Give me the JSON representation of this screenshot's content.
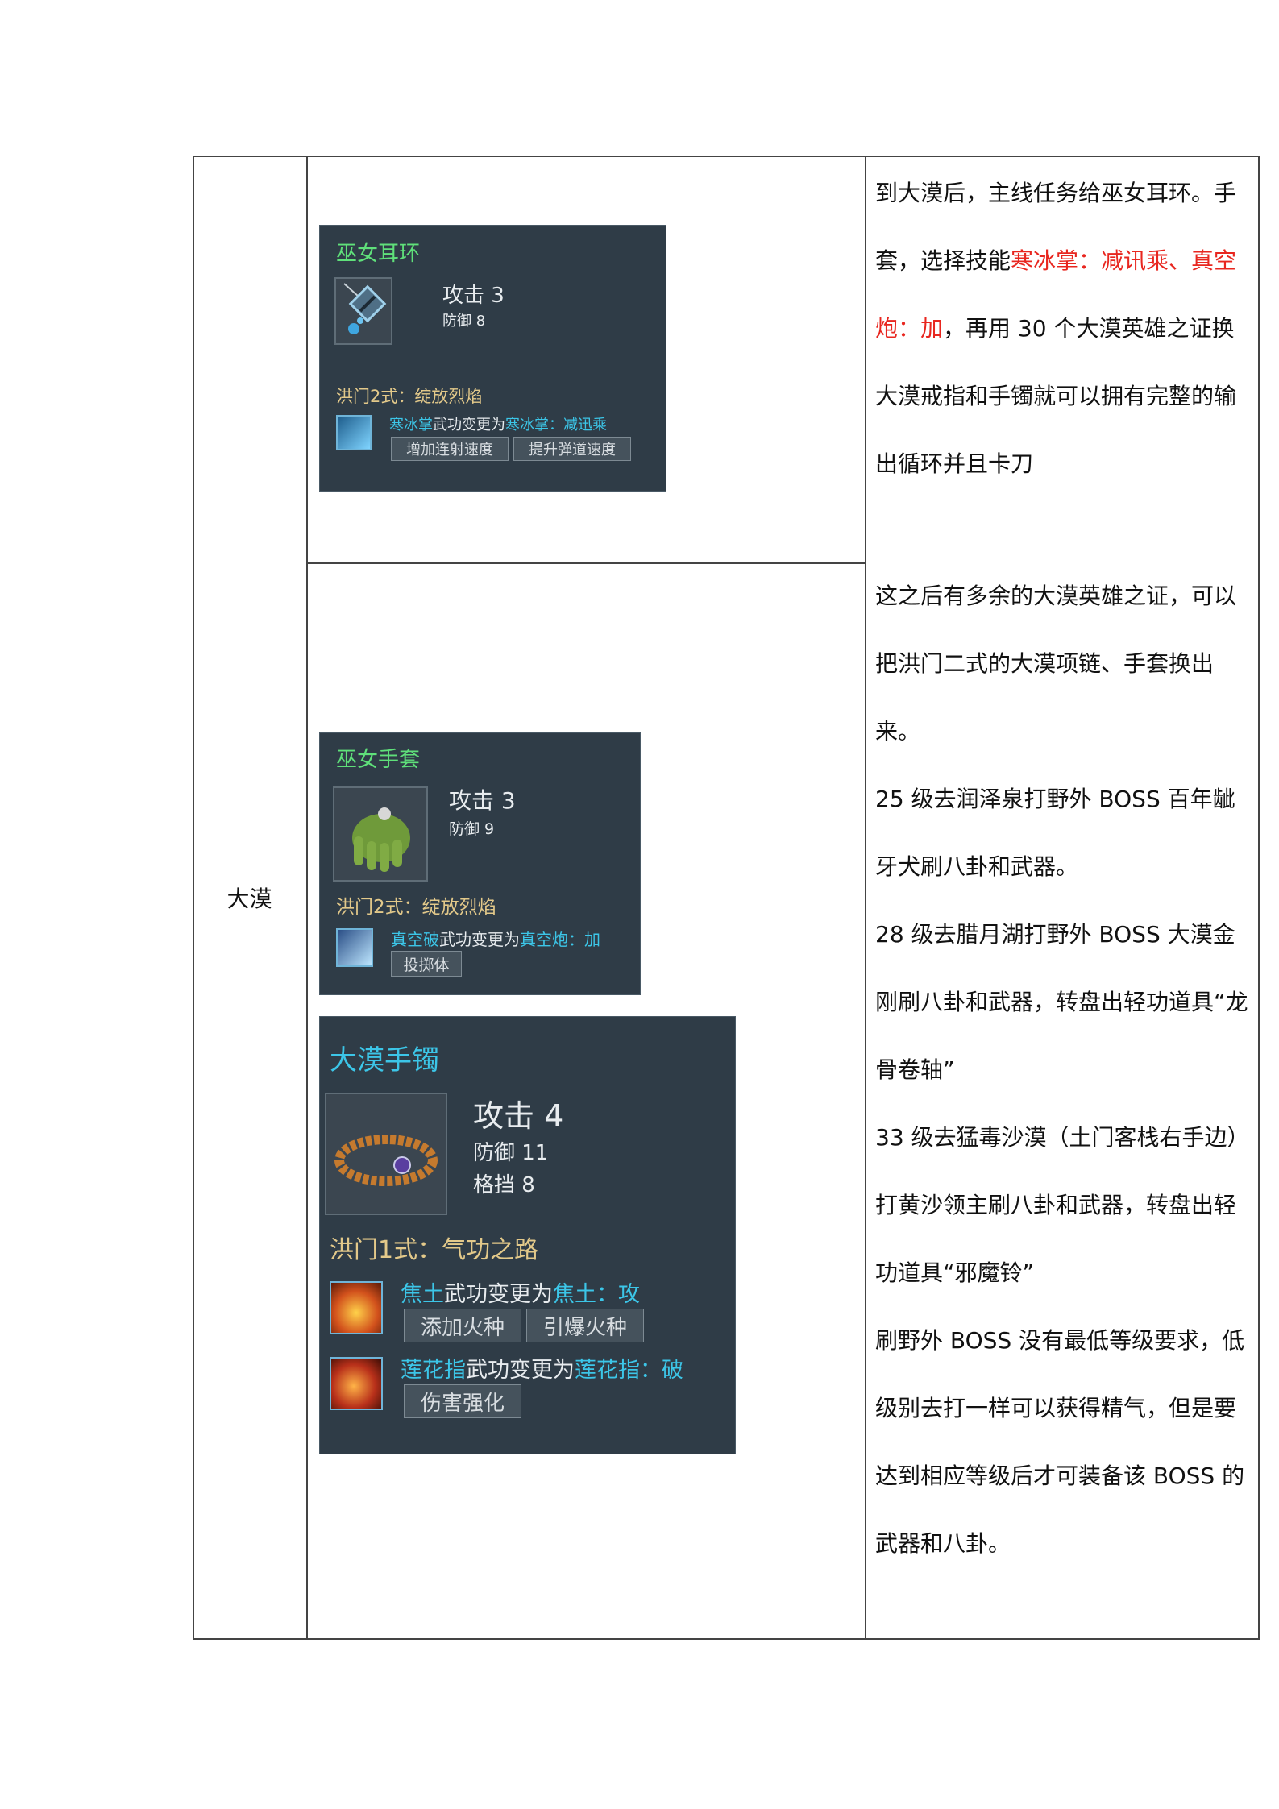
{
  "region": "大漠",
  "right_col": {
    "p1": {
      "a": "到大漠后，主线任务给巫女耳环。手套，选择技能",
      "red": "寒冰掌：减讯乘、真空炮：加",
      "b": "，再用 30 个大漠英雄之证换大漠戒指和手镯就可以拥有完整的输出循环并且卡刀"
    },
    "p2": "这之后有多余的大漠英雄之证，可以把洪门二式的大漠项链、手套换出来。",
    "p3": "25 级去润泽泉打野外 BOSS 百年龇牙犬刷八卦和武器。",
    "p4": "28 级去腊月湖打野外 BOSS 大漠金刚刷八卦和武器，转盘出轻功道具“龙骨卷轴”",
    "p5": "33 级去猛毒沙漠（土门客栈右手边）打黄沙领主刷八卦和武器，转盘出轻功道具“邪魔铃”",
    "p6": "刷野外 BOSS 没有最低等级要求，低级别去打一样可以获得精气，但是要达到相应等级后才可装备该 BOSS 的武器和八卦。"
  },
  "card1": {
    "name": "巫女耳环",
    "attack": "攻击 3",
    "defense": "防御 8",
    "set": "洪门2式：绽放烈焰",
    "skill": {
      "from": "寒冰掌",
      "mid": "武功变更为",
      "to": "寒冰掌：减迅乘"
    },
    "tags": [
      "增加连射速度",
      "提升弹道速度"
    ]
  },
  "card2": {
    "name": "巫女手套",
    "attack": "攻击 3",
    "defense": "防御 9",
    "set": "洪门2式：绽放烈焰",
    "skill": {
      "from": "真空破",
      "mid": "武功变更为",
      "to": "真空炮：加"
    },
    "tags": [
      "投掷体"
    ]
  },
  "card3": {
    "name": "大漠手镯",
    "attack": "攻击 4",
    "defense": "防御 11",
    "block": "格挡 8",
    "set": "洪门1式：气功之路",
    "skill1": {
      "from": "焦土",
      "mid": "武功变更为",
      "to": "焦土：攻"
    },
    "tags1": [
      "添加火种",
      "引爆火种"
    ],
    "skill2": {
      "from": "莲花指",
      "mid": "武功变更为",
      "to": "莲花指：破"
    },
    "tags2": [
      "伤害强化"
    ]
  },
  "colors": {
    "item_green": "#5fe07a",
    "item_cyan": "#3cc6e8",
    "set_gold": "#e3c98a",
    "highlight_red": "#e8261f"
  }
}
